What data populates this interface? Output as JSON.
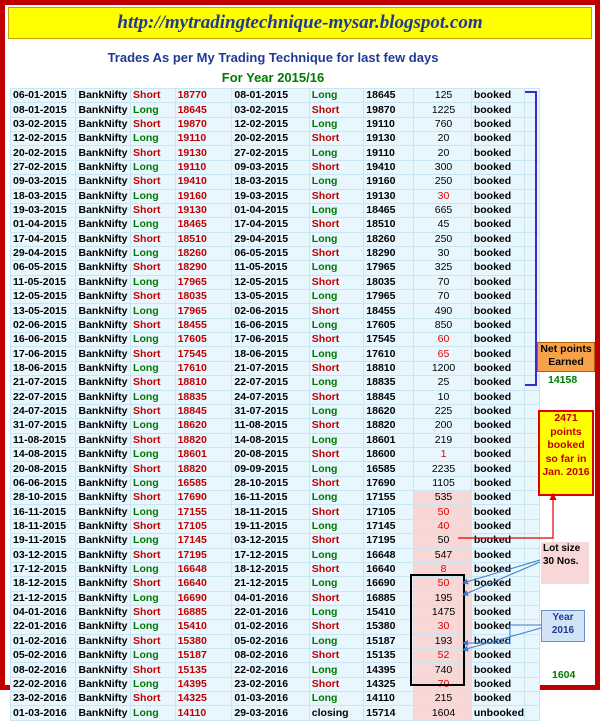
{
  "header": {
    "url": "http://mytradingtechnique-mysar.blogspot.com"
  },
  "title": "Trades As per My Trading Technique for last few days",
  "subtitle": "For Year 2015/16",
  "rows": [
    [
      "06-01-2015",
      "BankNifty",
      "Short",
      "18770",
      "08-01-2015",
      "Long",
      "18645",
      "125",
      "booked"
    ],
    [
      "08-01-2015",
      "BankNifty",
      "Long",
      "18645",
      "03-02-2015",
      "Short",
      "19870",
      "1225",
      "booked"
    ],
    [
      "03-02-2015",
      "BankNifty",
      "Short",
      "19870",
      "12-02-2015",
      "Long",
      "19110",
      "760",
      "booked"
    ],
    [
      "12-02-2015",
      "BankNifty",
      "Long",
      "19110",
      "20-02-2015",
      "Short",
      "19130",
      "20",
      "booked"
    ],
    [
      "20-02-2015",
      "BankNifty",
      "Short",
      "19130",
      "27-02-2015",
      "Long",
      "19110",
      "20",
      "booked"
    ],
    [
      "27-02-2015",
      "BankNifty",
      "Long",
      "19110",
      "09-03-2015",
      "Short",
      "19410",
      "300",
      "booked"
    ],
    [
      "09-03-2015",
      "BankNifty",
      "Short",
      "19410",
      "18-03-2015",
      "Long",
      "19160",
      "250",
      "booked"
    ],
    [
      "18-03-2015",
      "BankNifty",
      "Long",
      "19160",
      "19-03-2015",
      "Short",
      "19130",
      "30",
      "booked"
    ],
    [
      "19-03-2015",
      "BankNifty",
      "Short",
      "19130",
      "01-04-2015",
      "Long",
      "18465",
      "665",
      "booked"
    ],
    [
      "01-04-2015",
      "BankNifty",
      "Long",
      "18465",
      "17-04-2015",
      "Short",
      "18510",
      "45",
      "booked"
    ],
    [
      "17-04-2015",
      "BankNifty",
      "Short",
      "18510",
      "29-04-2015",
      "Long",
      "18260",
      "250",
      "booked"
    ],
    [
      "29-04-2015",
      "BankNifty",
      "Long",
      "18260",
      "06-05-2015",
      "Short",
      "18290",
      "30",
      "booked"
    ],
    [
      "06-05-2015",
      "BankNifty",
      "Short",
      "18290",
      "11-05-2015",
      "Long",
      "17965",
      "325",
      "booked"
    ],
    [
      "11-05-2015",
      "BankNifty",
      "Long",
      "17965",
      "12-05-2015",
      "Short",
      "18035",
      "70",
      "booked"
    ],
    [
      "12-05-2015",
      "BankNifty",
      "Short",
      "18035",
      "13-05-2015",
      "Long",
      "17965",
      "70",
      "booked"
    ],
    [
      "13-05-2015",
      "BankNifty",
      "Long",
      "17965",
      "02-06-2015",
      "Short",
      "18455",
      "490",
      "booked"
    ],
    [
      "02-06-2015",
      "BankNifty",
      "Short",
      "18455",
      "16-06-2015",
      "Long",
      "17605",
      "850",
      "booked"
    ],
    [
      "16-06-2015",
      "BankNifty",
      "Long",
      "17605",
      "17-06-2015",
      "Short",
      "17545",
      "60",
      "booked"
    ],
    [
      "17-06-2015",
      "BankNifty",
      "Short",
      "17545",
      "18-06-2015",
      "Long",
      "17610",
      "65",
      "booked"
    ],
    [
      "18-06-2015",
      "BankNifty",
      "Long",
      "17610",
      "21-07-2015",
      "Short",
      "18810",
      "1200",
      "booked"
    ],
    [
      "21-07-2015",
      "BankNifty",
      "Short",
      "18810",
      "22-07-2015",
      "Long",
      "18835",
      "25",
      "booked"
    ],
    [
      "22-07-2015",
      "BankNifty",
      "Long",
      "18835",
      "24-07-2015",
      "Short",
      "18845",
      "10",
      "booked"
    ],
    [
      "24-07-2015",
      "BankNifty",
      "Short",
      "18845",
      "31-07-2015",
      "Long",
      "18620",
      "225",
      "booked"
    ],
    [
      "31-07-2015",
      "BankNifty",
      "Long",
      "18620",
      "11-08-2015",
      "Short",
      "18820",
      "200",
      "booked"
    ],
    [
      "11-08-2015",
      "BankNifty",
      "Short",
      "18820",
      "14-08-2015",
      "Long",
      "18601",
      "219",
      "booked"
    ],
    [
      "14-08-2015",
      "BankNifty",
      "Long",
      "18601",
      "20-08-2015",
      "Short",
      "18600",
      "1",
      "booked"
    ],
    [
      "20-08-2015",
      "BankNifty",
      "Short",
      "18820",
      "09-09-2015",
      "Long",
      "16585",
      "2235",
      "booked"
    ],
    [
      "06-06-2015",
      "BankNifty",
      "Long",
      "16585",
      "28-10-2015",
      "Short",
      "17690",
      "1105",
      "booked"
    ],
    [
      "28-10-2015",
      "BankNifty",
      "Short",
      "17690",
      "16-11-2015",
      "Long",
      "17155",
      "535",
      "booked"
    ],
    [
      "16-11-2015",
      "BankNifty",
      "Long",
      "17155",
      "18-11-2015",
      "Short",
      "17105",
      "50",
      "booked"
    ],
    [
      "18-11-2015",
      "BankNifty",
      "Short",
      "17105",
      "19-11-2015",
      "Long",
      "17145",
      "40",
      "booked"
    ],
    [
      "19-11-2015",
      "BankNifty",
      "Long",
      "17145",
      "03-12-2015",
      "Short",
      "17195",
      "50",
      "booked"
    ],
    [
      "03-12-2015",
      "BankNifty",
      "Short",
      "17195",
      "17-12-2015",
      "Long",
      "16648",
      "547",
      "booked"
    ],
    [
      "17-12-2015",
      "BankNifty",
      "Long",
      "16648",
      "18-12-2015",
      "Short",
      "16640",
      "8",
      "booked"
    ],
    [
      "18-12-2015",
      "BankNifty",
      "Short",
      "16640",
      "21-12-2015",
      "Long",
      "16690",
      "50",
      "booked"
    ],
    [
      "21-12-2015",
      "BankNifty",
      "Long",
      "16690",
      "04-01-2016",
      "Short",
      "16885",
      "195",
      "booked"
    ],
    [
      "04-01-2016",
      "BankNifty",
      "Short",
      "16885",
      "22-01-2016",
      "Long",
      "15410",
      "1475",
      "booked"
    ],
    [
      "22-01-2016",
      "BankNifty",
      "Long",
      "15410",
      "01-02-2016",
      "Short",
      "15380",
      "30",
      "booked"
    ],
    [
      "01-02-2016",
      "BankNifty",
      "Short",
      "15380",
      "05-02-2016",
      "Long",
      "15187",
      "193",
      "booked"
    ],
    [
      "05-02-2016",
      "BankNifty",
      "Long",
      "15187",
      "08-02-2016",
      "Short",
      "15135",
      "52",
      "booked"
    ],
    [
      "08-02-2016",
      "BankNifty",
      "Short",
      "15135",
      "22-02-2016",
      "Long",
      "14395",
      "740",
      "booked"
    ],
    [
      "22-02-2016",
      "BankNifty",
      "Long",
      "14395",
      "23-02-2016",
      "Short",
      "14325",
      "70",
      "booked"
    ],
    [
      "23-02-2016",
      "BankNifty",
      "Short",
      "14325",
      "01-03-2016",
      "Long",
      "14110",
      "215",
      "booked"
    ],
    [
      "01-03-2016",
      "BankNifty",
      "Long",
      "14110",
      "29-03-2016",
      "closing",
      "15714",
      "1604",
      "unbooked"
    ]
  ],
  "red_points_rows": [
    7,
    17,
    18,
    25,
    29,
    30,
    33,
    34,
    37,
    39,
    41
  ],
  "pink_points_from_row": 28,
  "notes": {
    "net_points_label": "Net points Earned",
    "net_points_value": "14158",
    "points_booked_text": "2471 points booked so far in Jan. 2016",
    "lot_size_text": "Lot size 30 Nos.",
    "year_text": "Year 2016",
    "unbooked_value": "1604"
  },
  "colors": {
    "border": "#c00000",
    "header_bg": "#ffff00",
    "long": "#007a00",
    "short": "#c00000",
    "row_bg": "#e8f7fd"
  }
}
